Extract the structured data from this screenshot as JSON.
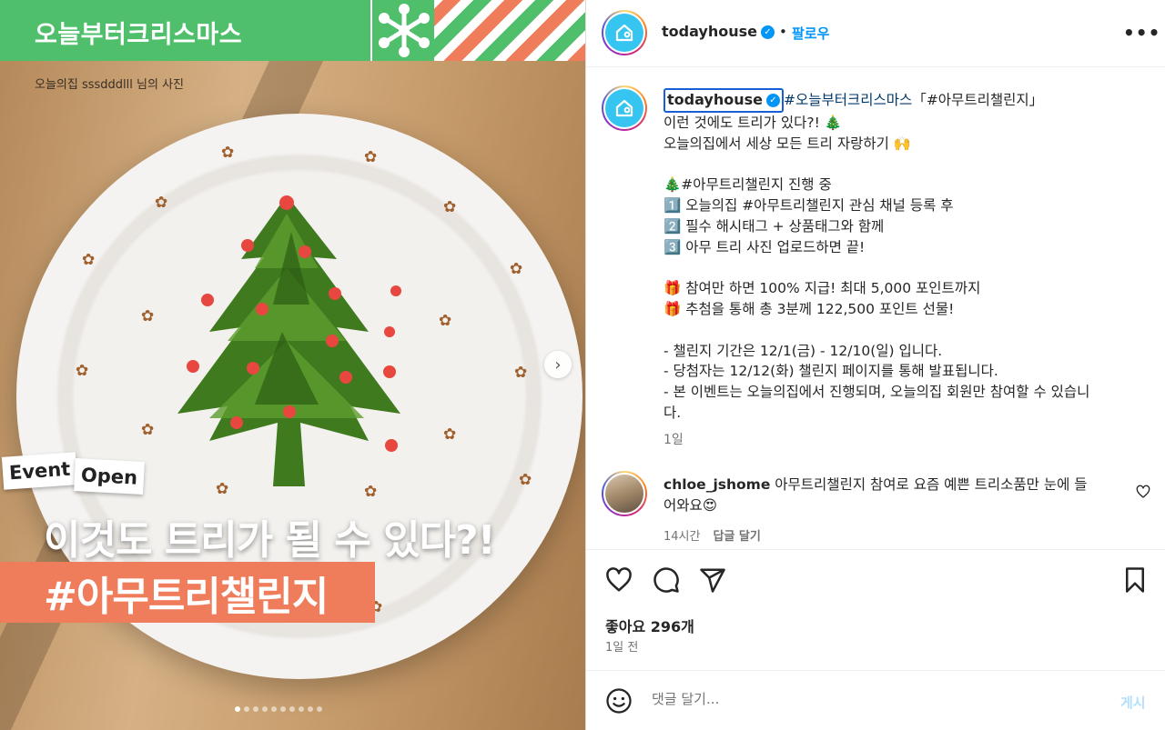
{
  "media": {
    "banner_title": "오늘부터크리스마스",
    "credit": "오늘의집 sssdddlll 님의 사진",
    "event_word1": "Event",
    "event_word2": "Open",
    "headline": "이것도 트리가 될 수 있다?!",
    "hashtag_banner": "#아무트리챌린지",
    "carousel_dots": 10,
    "carousel_active_index": 0
  },
  "header": {
    "username": "todayhouse",
    "separator": "•",
    "follow_label": "팔로우",
    "more_label": "•••"
  },
  "caption": {
    "username": "todayhouse",
    "first_line_tag": "#오늘부터크리스마스",
    "first_line_rest": "「#아무트리챌린지」",
    "lines": [
      "이런 것에도 트리가 있다?! 🎄",
      "오늘의집에서 세상 모든 트리 자랑하기 🙌",
      "",
      "🎄#아무트리챌린지 진행 중",
      "1️⃣ 오늘의집 #아무트리챌린지 관심 채널 등록 후",
      "2️⃣ 필수 해시태그 + 상품태그와 함께",
      "3️⃣ 아무 트리 사진 업로드하면 끝!",
      "",
      "🎁 참여만 하면 100% 지급! 최대 5,000 포인트까지",
      "🎁 추첨을 통해 총 3분께 122,500 포인트 선물!",
      "",
      "- 챌린지 기간은 12/1(금) - 12/10(일) 입니다.",
      "- 당첨자는 12/12(화) 챌린지 페이지를 통해 발표됩니다.",
      "- 본 이벤트는 오늘의집에서 진행되며, 오늘의집 회원만 참여할 수 있습니",
      "다."
    ],
    "time": "1일"
  },
  "comment": {
    "username": "chloe_jshome",
    "text_line1": " 아무트리챌린지 참여로 요즘 예쁜 트리소품만 눈에 들",
    "text_line2": "어와요😍",
    "time": "14시간",
    "reply_label": "답글 달기"
  },
  "footer": {
    "likes": "좋아요 296개",
    "date": "1일 전",
    "comment_placeholder": "댓글 달기...",
    "post_label": "게시"
  },
  "icons": {
    "like": "heart-icon",
    "comment": "comment-icon",
    "share": "send-icon",
    "save": "bookmark-icon",
    "emoji": "smiley-icon",
    "next": "chevron-right-icon",
    "verified": "verified-badge-icon"
  },
  "colors": {
    "brand_green": "#4fbf6b",
    "brand_coral": "#ef7c5b",
    "link_blue": "#0095f6",
    "hashtag_navy": "#00376b",
    "todayhouse_cyan": "#35c5f0"
  }
}
